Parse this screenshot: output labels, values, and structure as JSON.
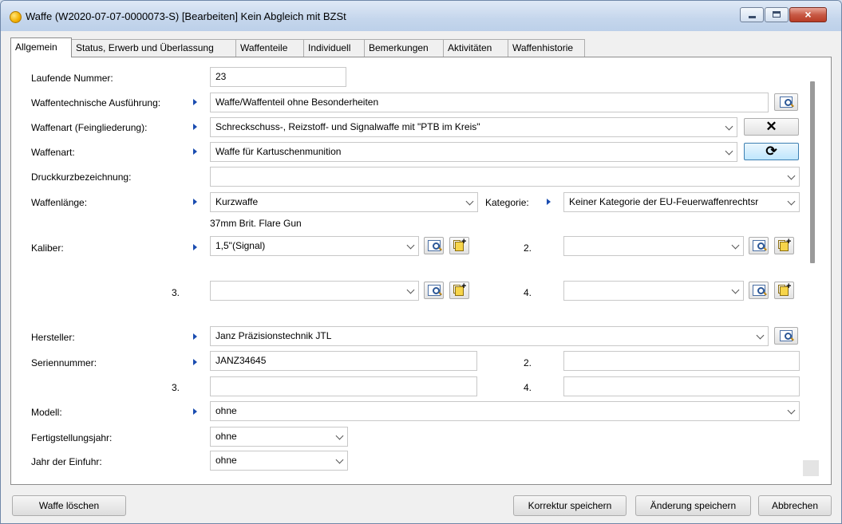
{
  "window": {
    "title": "Waffe (W2020-07-07-0000073-S) [Bearbeiten] Kein Abgleich mit BZSt",
    "close_glyph": "×"
  },
  "tabs": [
    {
      "label": "Allgemein"
    },
    {
      "label": "Status, Erwerb und Überlassung"
    },
    {
      "label": "Waffenteile"
    },
    {
      "label": "Individuell"
    },
    {
      "label": "Bemerkungen"
    },
    {
      "label": "Aktivitäten"
    },
    {
      "label": "Waffenhistorie"
    }
  ],
  "form": {
    "laufende_nummer": {
      "label": "Laufende Nummer:",
      "value": "23"
    },
    "ausfuehrung": {
      "label": "Waffentechnische Ausführung:",
      "value": "Waffe/Waffenteil ohne Besonderheiten"
    },
    "waffenart_fein": {
      "label": "Waffenart (Feingliederung):",
      "value": "Schreckschuss-, Reizstoff- und Signalwaffe mit \"PTB im Kreis\"",
      "clear_glyph": "✕"
    },
    "waffenart": {
      "label": "Waffenart:",
      "value": "Waffe für Kartuschenmunition",
      "refresh_glyph": "⟳"
    },
    "druckkurz": {
      "label": "Druckkurzbezeichnung:",
      "value": ""
    },
    "waffenlaenge": {
      "label": "Waffenlänge:",
      "value": "Kurzwaffe",
      "note": "37mm Brit. Flare Gun"
    },
    "kategorie": {
      "label": "Kategorie:",
      "value": "Keiner Kategorie der EU-Feuerwaffenrechtsr"
    },
    "kaliber": {
      "label": "Kaliber:",
      "value": "1,5\"(Signal)",
      "label2": "2.",
      "value2": "",
      "label3": "3.",
      "value3": "",
      "label4": "4.",
      "value4": ""
    },
    "hersteller": {
      "label": "Hersteller:",
      "value": "Janz Präzisionstechnik JTL"
    },
    "seriennummer": {
      "label": "Seriennummer:",
      "value": "JANZ34645",
      "label2": "2.",
      "value2": "",
      "label3": "3.",
      "value3": "",
      "label4": "4.",
      "value4": ""
    },
    "modell": {
      "label": "Modell:",
      "value": "ohne"
    },
    "fertigungsjahr": {
      "label": "Fertigstellungsjahr:",
      "value": "ohne"
    },
    "einfuhrjahr": {
      "label": "Jahr der Einfuhr:",
      "value": "ohne"
    }
  },
  "footer": {
    "delete": "Waffe löschen",
    "korrektur": "Korrektur speichern",
    "aenderung": "Änderung speichern",
    "abbrechen": "Abbrechen"
  },
  "colors": {
    "arrow": "#1a4cb0",
    "accent": "#3c7fb1"
  }
}
